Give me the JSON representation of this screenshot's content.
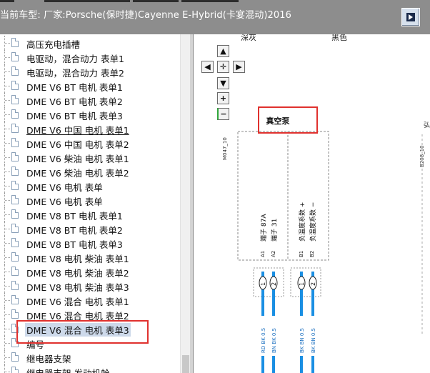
{
  "window": {
    "title": "当前车型:  厂家:Porsche(保时捷)Cayenne E-Hybrid(卡宴混动)2016",
    "close_icon": "window-toggle-icon"
  },
  "tree": {
    "items": [
      {
        "label": "高压充电插槽"
      },
      {
        "label": "电驱动，混合动力 表单1"
      },
      {
        "label": "电驱动，混合动力 表单2"
      },
      {
        "label": "DME V6 BT 电机 表单1"
      },
      {
        "label": "DME V6 BT 电机 表单2"
      },
      {
        "label": "DME V6 BT 电机 表单3"
      },
      {
        "label": "DME V6 中国 电机 表单1",
        "underline": true
      },
      {
        "label": "DME V6 中国 电机 表单2"
      },
      {
        "label": "DME V6 柴油 电机 表单1"
      },
      {
        "label": "DME V6 柴油 电机 表单2"
      },
      {
        "label": "DME V6 电机 表单"
      },
      {
        "label": "DME V6 电机 表单"
      },
      {
        "label": "DME V8 BT 电机 表单1"
      },
      {
        "label": "DME V8 BT 电机 表单2"
      },
      {
        "label": "DME V8 BT 电机 表单3"
      },
      {
        "label": "DME V8 电机 柴油 表单1"
      },
      {
        "label": "DME V8 电机 柴油 表单2"
      },
      {
        "label": "DME V8 电机 柴油 表单3"
      },
      {
        "label": "DME V6 混合 电机 表单1"
      },
      {
        "label": "DME V6 混合 电机 表单2"
      },
      {
        "label": "DME V6 混合 电机 表单3",
        "selected": true
      },
      {
        "label": "编号"
      },
      {
        "label": "继电器支架"
      },
      {
        "label": "继电器支架 发动机舱"
      }
    ]
  },
  "diagram": {
    "header_labels": [
      "深灰",
      "黑色"
    ],
    "nav_buttons": {
      "up": "▲",
      "left": "◀",
      "center": "✛",
      "right": "▶",
      "down": "▼",
      "zoom_in": "+",
      "zoom_out": "−"
    },
    "component_title": "真空泵",
    "left_connector": "M047_10",
    "right_connector": "B208_10",
    "pins": [
      {
        "num": "A1",
        "label": "端子 87A"
      },
      {
        "num": "A2",
        "label": "端子 31"
      },
      {
        "num": "B1",
        "label": "负温度系数 +"
      },
      {
        "num": "B2",
        "label": "负温度系数 −"
      }
    ],
    "wire_nums": [
      "1",
      "2",
      "1",
      "2"
    ],
    "wire_labels": [
      "RD BK 0.5",
      "BN BK 0.5",
      "BK BN 0.5",
      "BK BN 0.5"
    ],
    "edge_char": "弘"
  },
  "colors": {
    "highlight": "#e0312e",
    "wire": "#1a8fe3",
    "selection": "#cdd9ea"
  }
}
